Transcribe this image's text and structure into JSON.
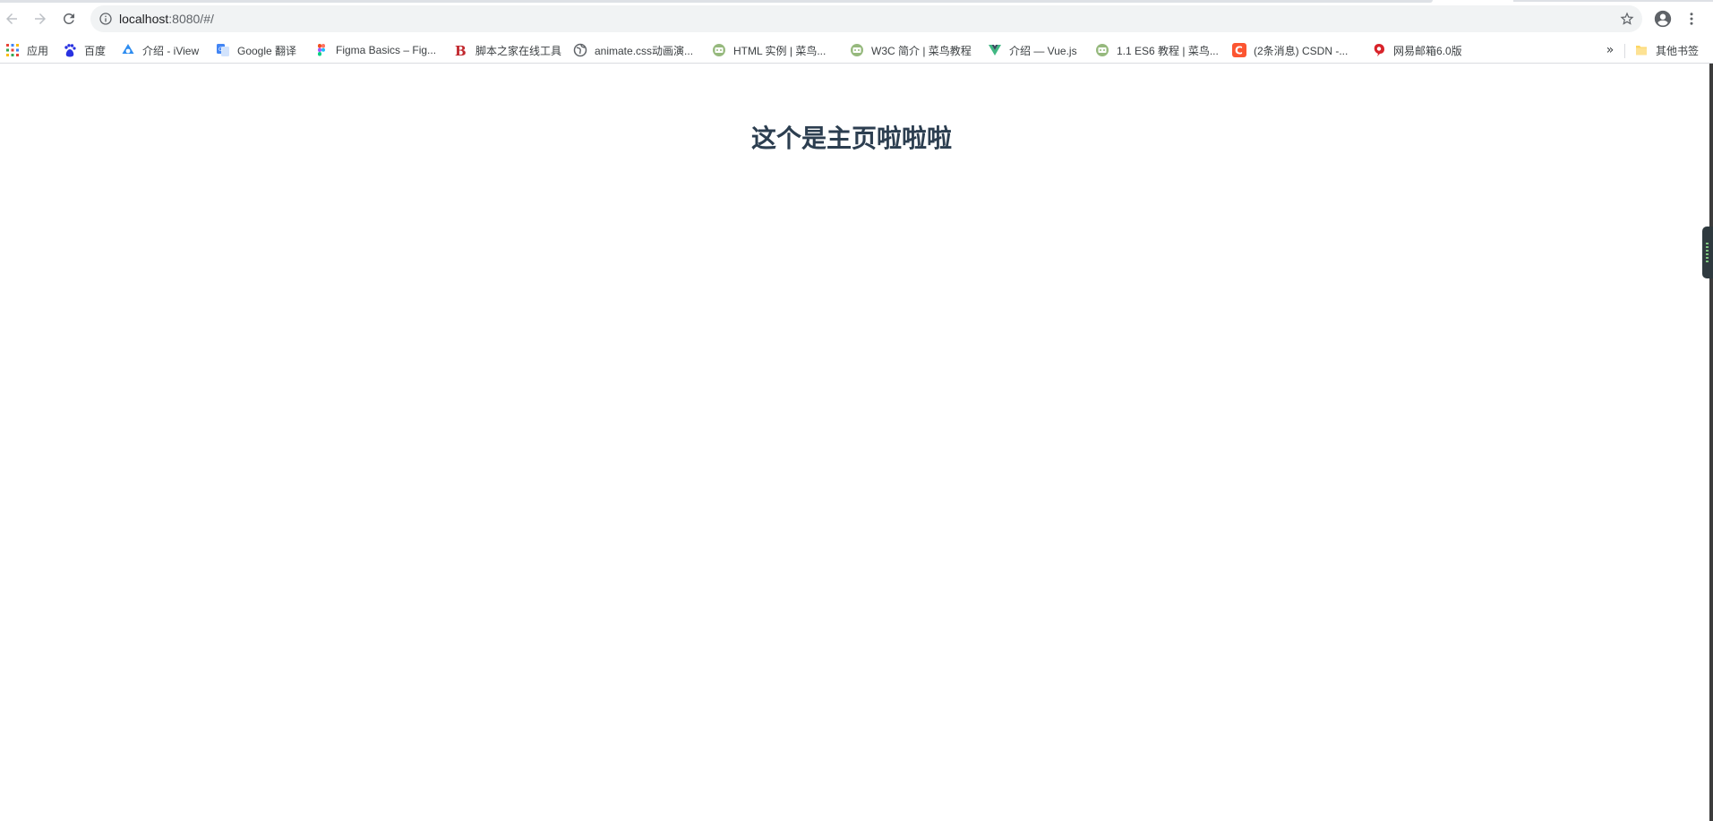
{
  "browser": {
    "url": {
      "host": "localhost",
      "path": ":8080/#/"
    },
    "icons": {
      "back": "back-arrow-icon",
      "forward": "forward-arrow-icon",
      "reload": "reload-icon",
      "info": "info-icon",
      "star": "star-icon",
      "profile": "profile-icon",
      "menu": "kebab-menu-icon"
    }
  },
  "bookmarks": {
    "items": [
      {
        "label": "应用",
        "icon": "apps-grid-icon"
      },
      {
        "label": "百度",
        "icon": "baidu-paw-icon"
      },
      {
        "label": "介绍 - iView",
        "icon": "iview-icon"
      },
      {
        "label": "Google 翻译",
        "icon": "google-translate-icon"
      },
      {
        "label": "Figma Basics – Fig...",
        "icon": "figma-icon"
      },
      {
        "label": "脚本之家在线工具",
        "icon": "jb51-icon"
      },
      {
        "label": "animate.css动画演...",
        "icon": "globe-icon"
      },
      {
        "label": "HTML 实例 | 菜鸟...",
        "icon": "runoob-icon"
      },
      {
        "label": "W3C 简介 | 菜鸟教程",
        "icon": "runoob-icon"
      },
      {
        "label": "介绍 — Vue.js",
        "icon": "vue-icon"
      },
      {
        "label": "1.1 ES6 教程 | 菜鸟...",
        "icon": "runoob-icon"
      },
      {
        "label": "(2条消息) CSDN -...",
        "icon": "csdn-icon"
      },
      {
        "label": "网易邮箱6.0版",
        "icon": "netease-icon"
      }
    ],
    "overflow": "»",
    "other": {
      "label": "其他书签",
      "icon": "folder-icon"
    }
  },
  "page": {
    "heading": "这个是主页啦啦啦"
  },
  "colors": {
    "heading": "#2c3e50",
    "omnibox_bg": "#f1f3f4",
    "baidu": "#2932e1",
    "iview": "#2d8cf0",
    "vue": "#41b883",
    "csdn": "#fc5531",
    "netease": "#d8232a",
    "runoob": "#96b97d"
  }
}
